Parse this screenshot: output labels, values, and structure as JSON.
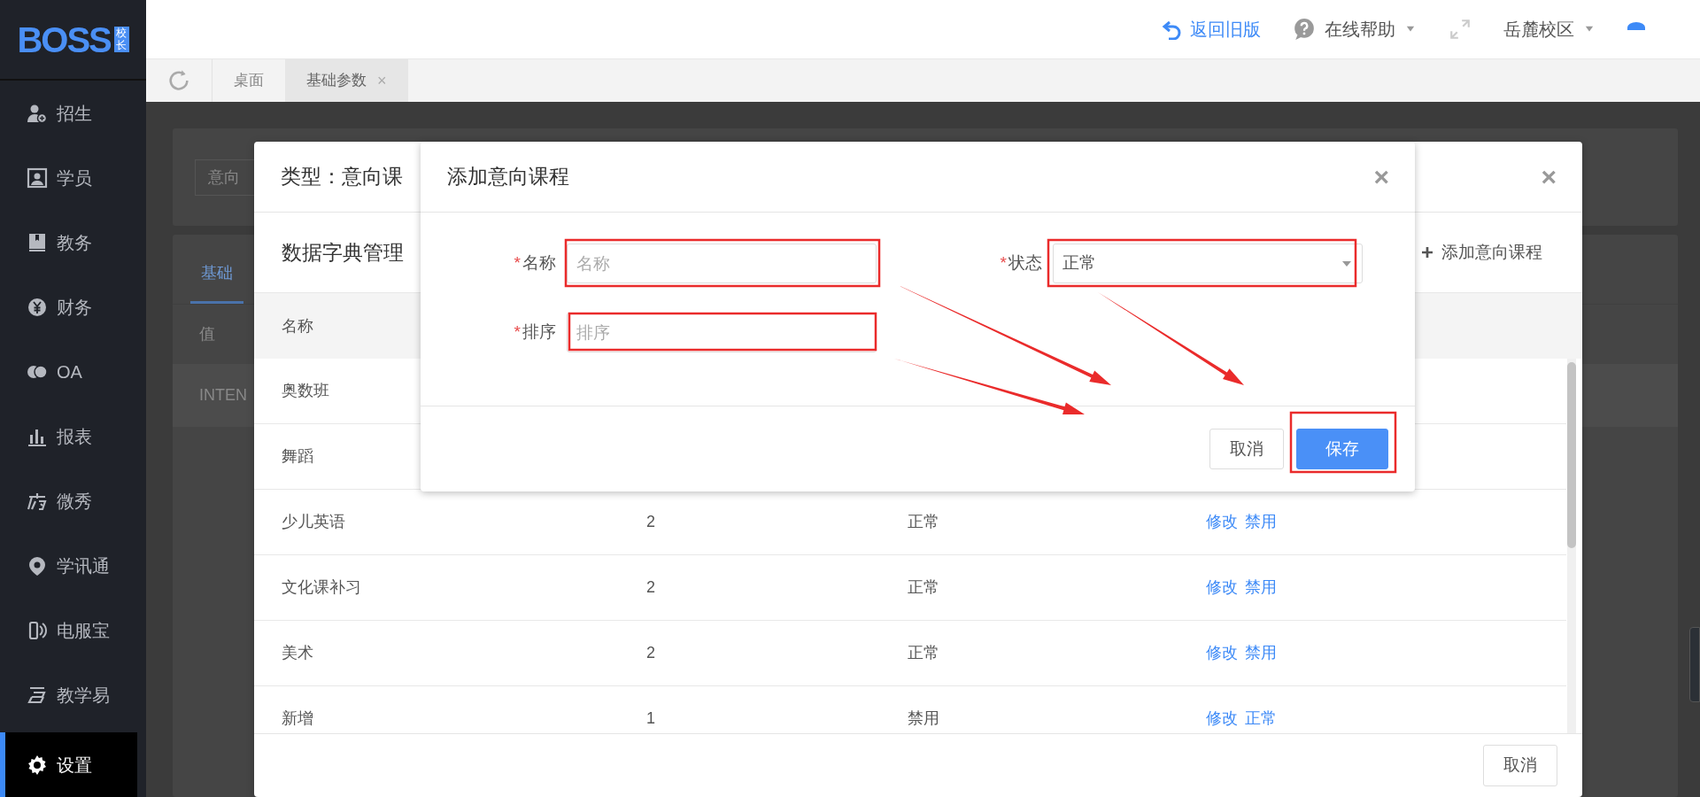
{
  "logo": {
    "text": "BOSS",
    "tag": "校长"
  },
  "sidebar": {
    "items": [
      {
        "label": "招生",
        "selected": false
      },
      {
        "label": "学员",
        "selected": false
      },
      {
        "label": "教务",
        "selected": false
      },
      {
        "label": "财务",
        "selected": false
      },
      {
        "label": "OA",
        "selected": false
      },
      {
        "label": "报表",
        "selected": false
      },
      {
        "label": "微秀",
        "selected": false
      },
      {
        "label": "学讯通",
        "selected": false
      },
      {
        "label": "电服宝",
        "selected": false
      },
      {
        "label": "教学易",
        "selected": false
      },
      {
        "label": "设置",
        "selected": true
      }
    ]
  },
  "topbar": {
    "back_link": "返回旧版",
    "help": "在线帮助",
    "campus": "岳麓校区"
  },
  "tabs": [
    {
      "label": "桌面",
      "selected": false
    },
    {
      "label": "基础参数",
      "selected": true,
      "close": "×"
    }
  ],
  "background_page": {
    "filter_select": "意向",
    "tab": "基础",
    "header": "值",
    "row": "INTEN"
  },
  "type_dialog": {
    "title": "类型：意向课",
    "close": "×",
    "section_title": "数据字典管理",
    "add_button": "添加意向课程",
    "columns": [
      "名称"
    ],
    "rows": [
      {
        "name": "奥数班"
      },
      {
        "name": "舞蹈"
      },
      {
        "name": "少儿英语",
        "sort": "2",
        "status": "正常",
        "actions": [
          "修改",
          "禁用"
        ]
      },
      {
        "name": "文化课补习",
        "sort": "2",
        "status": "正常",
        "actions": [
          "修改",
          "禁用"
        ]
      },
      {
        "name": "美术",
        "sort": "2",
        "status": "正常",
        "actions": [
          "修改",
          "禁用"
        ]
      },
      {
        "name": "新增",
        "sort": "1",
        "status": "禁用",
        "actions": [
          "修改",
          "正常"
        ]
      }
    ],
    "cancel": "取消"
  },
  "add_dialog": {
    "title": "添加意向课程",
    "close": "×",
    "fields": [
      {
        "kind": "text",
        "required_mark": "*",
        "label": "名称",
        "placeholder": "名称"
      },
      {
        "kind": "select",
        "required_mark": "*",
        "label": "状态",
        "value": "正常"
      },
      {
        "kind": "text",
        "required_mark": "*",
        "label": "排序",
        "placeholder": "排序"
      }
    ],
    "buttons": [
      {
        "kind": "default",
        "label": "取消"
      },
      {
        "kind": "primary",
        "label": "保存"
      }
    ]
  }
}
